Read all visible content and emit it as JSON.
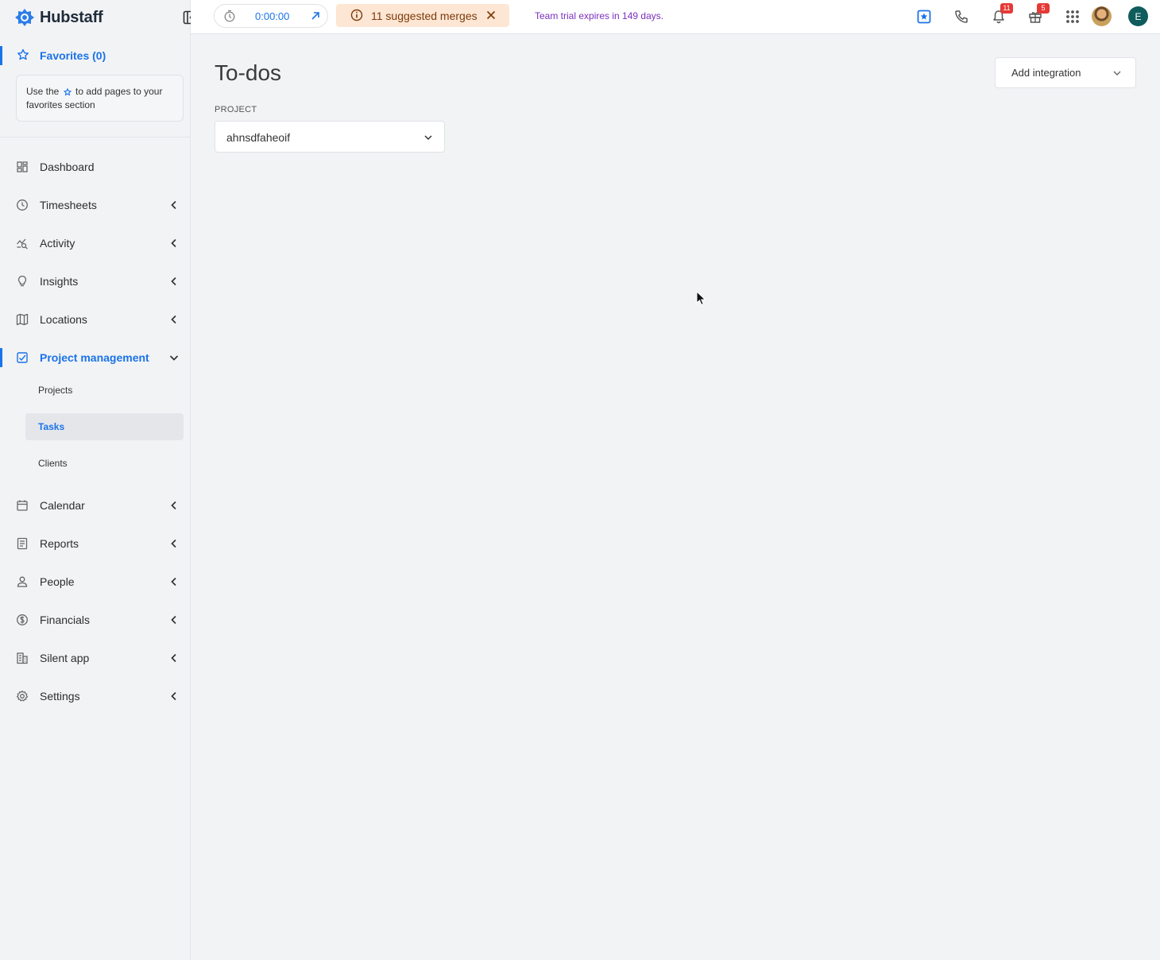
{
  "app": {
    "name": "Hubstaff"
  },
  "sidebar": {
    "favorites_label": "Favorites (0)",
    "favorites_hint_before": "Use the",
    "favorites_hint_after": "to add pages to your favorites section",
    "items": [
      {
        "label": "Dashboard",
        "icon": "dashboard-icon"
      },
      {
        "label": "Timesheets",
        "icon": "clock-icon"
      },
      {
        "label": "Activity",
        "icon": "activity-icon"
      },
      {
        "label": "Insights",
        "icon": "lightbulb-icon"
      },
      {
        "label": "Locations",
        "icon": "map-icon"
      },
      {
        "label": "Project management",
        "icon": "project-icon"
      },
      {
        "label": "Calendar",
        "icon": "calendar-icon"
      },
      {
        "label": "Reports",
        "icon": "report-icon"
      },
      {
        "label": "People",
        "icon": "person-icon"
      },
      {
        "label": "Financials",
        "icon": "dollar-icon"
      },
      {
        "label": "Silent app",
        "icon": "building-icon"
      },
      {
        "label": "Settings",
        "icon": "gear-icon"
      }
    ],
    "sub_items": [
      {
        "label": "Projects"
      },
      {
        "label": "Tasks"
      },
      {
        "label": "Clients"
      }
    ]
  },
  "topbar": {
    "timer_value": "0:00:00",
    "merges_label": "11 suggested merges",
    "trial_text": "Team trial expires in 149 days.",
    "notifications_count": "11",
    "gifts_count": "5",
    "user_initial": "E"
  },
  "main": {
    "title": "To-dos",
    "add_integration_label": "Add integration",
    "project_label": "PROJECT",
    "project_value": "ahnsdfaheoif"
  },
  "colors": {
    "accent": "#1a73e8",
    "warning_bg": "#fde6d3",
    "trial_text": "#7b2fbe",
    "badge": "#e53935",
    "avatar": "#0f5c5c"
  }
}
